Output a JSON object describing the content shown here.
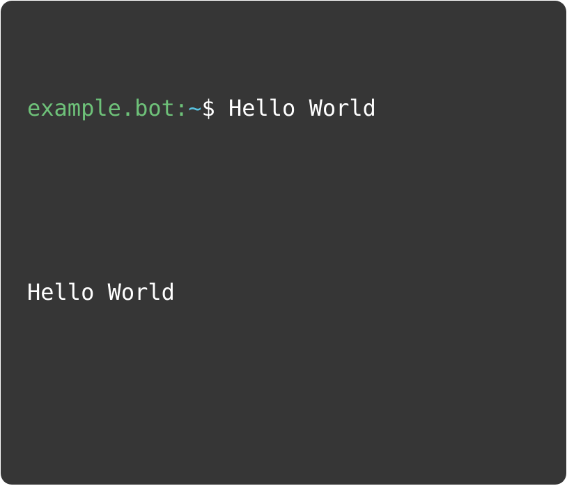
{
  "terminal": {
    "prompt": {
      "host": "example.bot:",
      "path": "~",
      "symbol": "$ "
    },
    "command": "Hello World",
    "output": "Hello World"
  },
  "colors": {
    "background": "#363636",
    "host": "#6ec179",
    "path": "#58c2e0",
    "text": "#ffffff"
  }
}
